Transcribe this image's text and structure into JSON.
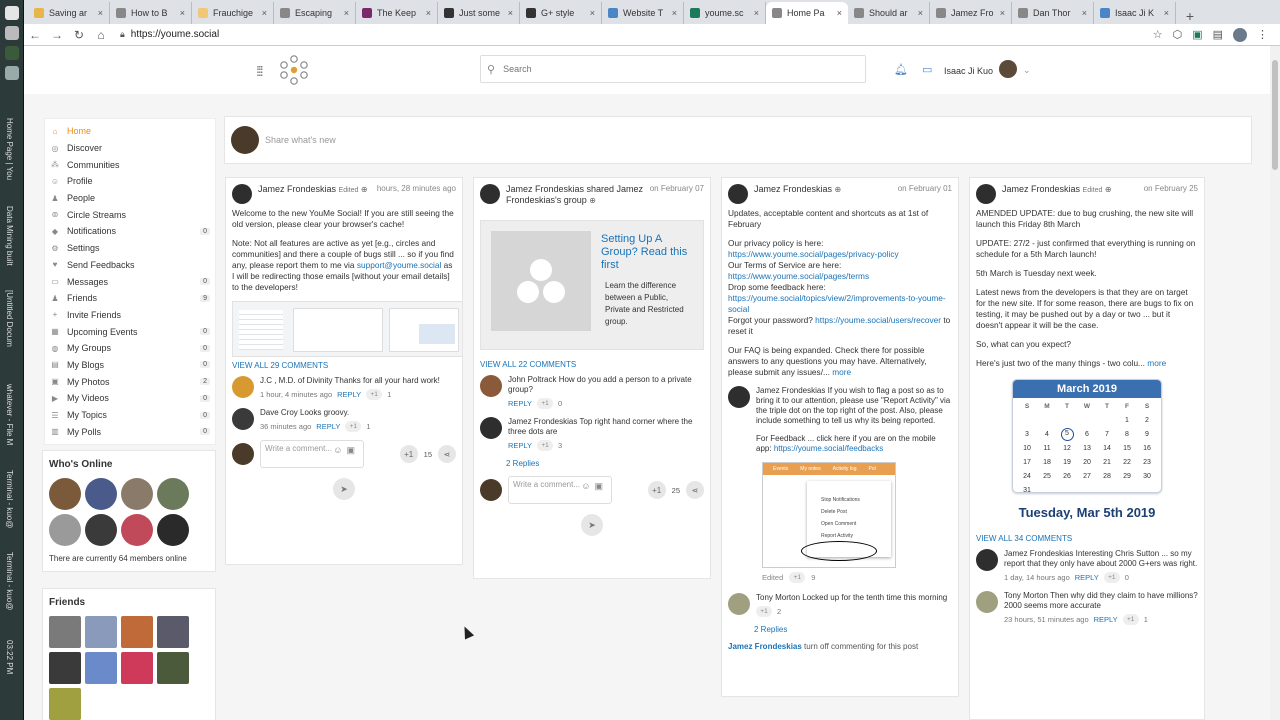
{
  "os_dock": {
    "vertical_labels": [
      "Home Page | You",
      "Data Mining built",
      "[Untitled Docum",
      "whatever - File M",
      "Terminal - kuo@",
      "Terminal - kuo@"
    ],
    "clock": "03:22 PM"
  },
  "browser": {
    "tabs": [
      {
        "title": "Saving ar",
        "color": "#e8b54a"
      },
      {
        "title": "How to B",
        "color": "#888888"
      },
      {
        "title": "Frauchige",
        "color": "#f0c878"
      },
      {
        "title": "Escaping",
        "color": "#888888"
      },
      {
        "title": "The Keep",
        "color": "#7a2a6a"
      },
      {
        "title": "Just some",
        "color": "#333333"
      },
      {
        "title": "G+ style",
        "color": "#333333"
      },
      {
        "title": "Website T",
        "color": "#4a86c6"
      },
      {
        "title": "youme.sc",
        "color": "#1a7a5a"
      },
      {
        "title": "Home Pa",
        "color": "#888888",
        "active": true
      },
      {
        "title": "Should ar",
        "color": "#888888"
      },
      {
        "title": "Jamez Fro",
        "color": "#888888"
      },
      {
        "title": "Dan Thor",
        "color": "#888888"
      },
      {
        "title": "Isaac Ji K",
        "color": "#4a86c6"
      }
    ],
    "url": "https://youme.social"
  },
  "header": {
    "search_placeholder": "Search",
    "user_name": "Isaac Ji Kuo"
  },
  "sidebar": {
    "items": [
      {
        "label": "Home",
        "icon": "home-icon",
        "glyph": "⌂",
        "count": "",
        "active": true
      },
      {
        "label": "Discover",
        "icon": "compass-icon",
        "glyph": "◎",
        "count": ""
      },
      {
        "label": "Communities",
        "icon": "communities-icon",
        "glyph": "⁂",
        "count": ""
      },
      {
        "label": "Profile",
        "icon": "profile-icon",
        "glyph": "☺",
        "count": ""
      },
      {
        "label": "People",
        "icon": "people-icon",
        "glyph": "♟",
        "count": ""
      },
      {
        "label": "Circle Streams",
        "icon": "circles-icon",
        "glyph": "⊚",
        "count": ""
      },
      {
        "label": "Notifications",
        "icon": "bell-icon",
        "glyph": "◆",
        "count": "0"
      },
      {
        "label": "Settings",
        "icon": "gear-icon",
        "glyph": "⚙",
        "count": ""
      },
      {
        "label": "Send Feedbacks",
        "icon": "heart-icon",
        "glyph": "♥",
        "count": ""
      },
      {
        "label": "Messages",
        "icon": "message-icon",
        "glyph": "▭",
        "count": "0"
      },
      {
        "label": "Friends",
        "icon": "friends-icon",
        "glyph": "♟",
        "count": "9"
      },
      {
        "label": "Invite Friends",
        "icon": "invite-icon",
        "glyph": "+",
        "count": ""
      },
      {
        "label": "Upcoming Events",
        "icon": "calendar-icon",
        "glyph": "▦",
        "count": "0"
      },
      {
        "label": "My Groups",
        "icon": "groups-icon",
        "glyph": "◍",
        "count": "0"
      },
      {
        "label": "My Blogs",
        "icon": "blog-icon",
        "glyph": "▤",
        "count": "0"
      },
      {
        "label": "My Photos",
        "icon": "photo-icon",
        "glyph": "▣",
        "count": "2"
      },
      {
        "label": "My Videos",
        "icon": "video-icon",
        "glyph": "▶",
        "count": "0"
      },
      {
        "label": "My Topics",
        "icon": "topics-icon",
        "glyph": "☰",
        "count": "0"
      },
      {
        "label": "My Polls",
        "icon": "poll-icon",
        "glyph": "▥",
        "count": "0"
      }
    ]
  },
  "whos_online": {
    "title": "Who's Online",
    "avatars": [
      "#7a5a3a",
      "#4a5a8a",
      "#8a7a6a",
      "#6a7a5a",
      "#9a9a9a",
      "#3a3a3a",
      "#c04a5a",
      "#2a2a2a"
    ],
    "note": "There are currently 64 members online"
  },
  "friends_box": {
    "title": "Friends",
    "avatars": [
      "#7a7a7a",
      "#8a9aba",
      "#c06a3a",
      "#5a5a6a",
      "#3a3a3a",
      "#6a8aca",
      "#d03a5a",
      "#4a5a3a",
      "#a0a040"
    ]
  },
  "share": {
    "placeholder": "Share what's new"
  },
  "posts": [
    {
      "author": "Jamez Frondeskias",
      "edited": "Edited",
      "time": "hours, 28 minutes ago",
      "body": [
        "Welcome to the new YouMe Social! If you are still seeing the old version, please clear your browser's cache!",
        "Note: Not all features are active as yet [e.g., circles and communities] and there a couple of bugs still ... so if you find any, please report them to me via"
      ],
      "email_link": "support@youme.social",
      "body_tail": " as I will be redirecting those emails [without your email details] to the developers!",
      "view_all": "VIEW ALL 29 COMMENTS",
      "comments": [
        {
          "name": "J.C , M.D. of Divinity",
          "text": "Thanks for all your hard work!",
          "meta": "1 hour, 4 minutes ago",
          "reply": "REPLY",
          "plus": "+1",
          "count": "1",
          "color": "#d89a30"
        },
        {
          "name": "Dave Croy",
          "text": "Looks groovy.",
          "meta": "36 minutes ago",
          "reply": "REPLY",
          "plus": "+1",
          "count": "1",
          "color": "#3a3a3a"
        }
      ],
      "write_placeholder": "Write a comment...",
      "plus": "+1",
      "plus_count": "15"
    },
    {
      "author": "Jamez Frondeskias shared Jamez Frondeskias's group",
      "time": "on February 07",
      "card_title": "Setting Up A Group? Read this first",
      "card_desc": "Learn the difference between a Public, Private and Restricted group.",
      "view_all": "VIEW ALL 22 COMMENTS",
      "comments": [
        {
          "name": "John Poltrack",
          "text": "How do you add a person to a private group?",
          "meta": "",
          "reply": "REPLY",
          "plus": "+1",
          "count": "0",
          "color": "#8a5a3a"
        },
        {
          "name": "Jamez Frondeskias",
          "text": "Top right hand corner where the three dots are",
          "meta": "",
          "reply": "REPLY",
          "plus": "+1",
          "count": "3",
          "color": "#2e2e2e"
        }
      ],
      "replies": "2 Replies",
      "write_placeholder": "Write a comment...",
      "plus": "+1",
      "plus_count": "25"
    },
    {
      "author": "Jamez Frondeskias",
      "time": "on February 01",
      "intro": "Updates, acceptable content and shortcuts as at 1st of February",
      "privacy_label": "Our privacy policy is here:",
      "privacy_link": "https://www.youme.social/pages/privacy-policy",
      "terms_label": "Our Terms of Service are here:",
      "terms_link": "https://www.youme.social/pages/terms",
      "feedback_label": "Drop some feedback here:",
      "feedback_link": "https://youme.social/topics/view/2/improvements-to-youme-social",
      "forgot_label": "Forgot your password?",
      "forgot_link": "https://youme.social/users/recover",
      "forgot_tail": " to reset it",
      "faq": "Our FAQ is being expanded. Check there for possible answers to any questions you may have. Alternatively, please submit any issues/...",
      "more": "more",
      "top_comment": {
        "name": "Jamez Frondeskias",
        "text": "If you wish to flag a post so as to bring it to our attention, please use \"Report Activity\" via the triple dot on the top right of the post. Also, please include something to tell us why its being reported.",
        "text2": "For Feedback ... click here if you are on the mobile app:",
        "link": "https://youme.social/feedbacks",
        "color": "#2e2e2e"
      },
      "image_tabs": [
        "Events",
        "My notes",
        "Activity log",
        "Pol"
      ],
      "image_menu": [
        "Stop Notifications",
        "Delete Post",
        "Open Comment",
        "Report Activity"
      ],
      "edited_label": "Edited",
      "edited_plus": "+1",
      "edited_count": "9",
      "comment2": {
        "name": "Tony Morton",
        "text": "Locked up for the tenth time this morning",
        "plus": "+1",
        "count": "2",
        "color": "#a0a080"
      },
      "replies": "2 Replies",
      "closed_name": "Jamez Frondeskias",
      "closed_text": " turn off commenting for this post"
    },
    {
      "author": "Jamez Frondeskias",
      "edited": "Edited",
      "time": "on February 25",
      "paragraphs": [
        "AMENDED UPDATE: due to bug crushing, the new site will launch this Friday 8th March",
        "UPDATE: 27/2 - just confirmed that everything is running on schedule for a 5th March launch!",
        "5th March is Tuesday next week.",
        "Latest news from the developers is that they are on target for the new site. If for some reason, there are bugs to fix on testing, it may be pushed out by a day or two ... but it doesn't appear it will be the case.",
        "So, what can you expect?"
      ],
      "last_line": "Here's just two of the many things - two colu...",
      "more": "more",
      "calendar": {
        "month": "March 2019",
        "dow": [
          "S",
          "M",
          "T",
          "W",
          "T",
          "F",
          "S"
        ],
        "days": [
          "",
          "",
          "",
          "",
          "",
          "1",
          "2",
          "3",
          "4",
          "5",
          "6",
          "7",
          "8",
          "9",
          "10",
          "11",
          "12",
          "13",
          "14",
          "15",
          "16",
          "17",
          "18",
          "19",
          "20",
          "21",
          "22",
          "23",
          "24",
          "25",
          "26",
          "27",
          "28",
          "29",
          "30",
          "31"
        ],
        "highlight": "5",
        "caption": "Tuesday, Mar 5th 2019"
      },
      "view_all": "VIEW ALL 34 COMMENTS",
      "comments": [
        {
          "name": "Jamez Frondeskias",
          "text": "Interesting Chris Sutton ... so my report that they only have about 2000 G+ers was right.",
          "meta": "1 day, 14 hours ago",
          "reply": "REPLY",
          "plus": "+1",
          "count": "0",
          "color": "#2e2e2e"
        },
        {
          "name": "Tony Morton",
          "text": "Then why did they claim to have millions? 2000 seems more accurate",
          "meta": "23 hours, 51 minutes ago",
          "reply": "REPLY",
          "plus": "+1",
          "count": "1",
          "color": "#a0a080"
        }
      ]
    }
  ]
}
